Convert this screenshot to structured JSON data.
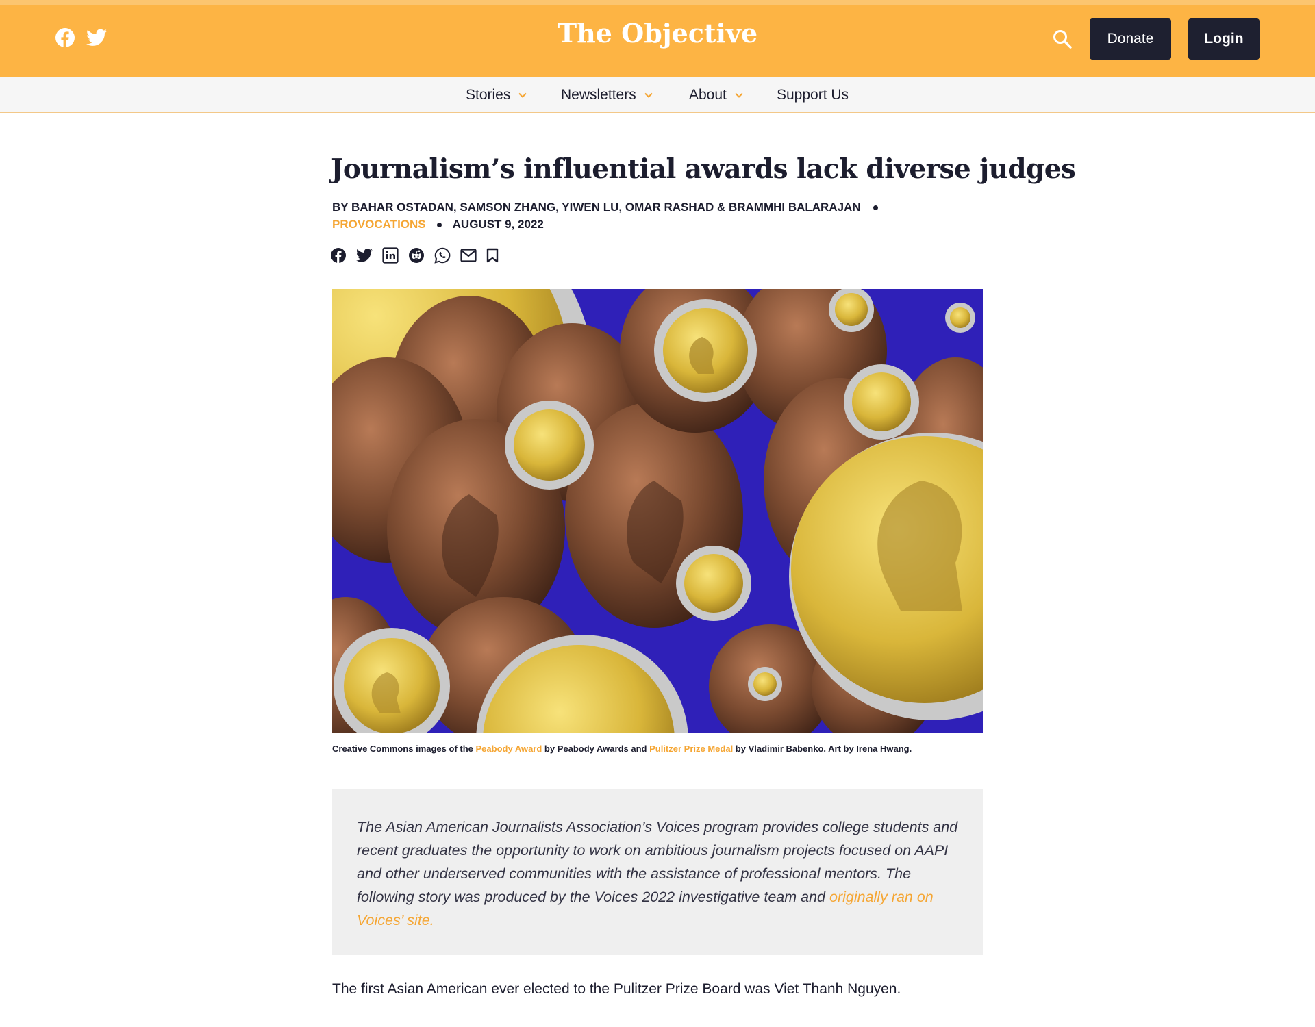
{
  "header": {
    "site_title": "The Objective",
    "donate_label": "Donate",
    "login_label": "Login",
    "social_icons": [
      "facebook-icon",
      "twitter-icon"
    ],
    "search_icon": "search-icon",
    "bg_color": "#fdb444",
    "button_color": "#1e2030"
  },
  "nav": {
    "items": [
      {
        "label": "Stories",
        "has_dropdown": true
      },
      {
        "label": "Newsletters",
        "has_dropdown": true
      },
      {
        "label": "About",
        "has_dropdown": true
      },
      {
        "label": "Support Us",
        "has_dropdown": false
      }
    ]
  },
  "article": {
    "title": "Journalism’s influential awards lack diverse judges",
    "byline": "BY BAHAR OSTADAN, SAMSON ZHANG, YIWEN LU, OMAR RASHAD & BRAMMHI BALARAJAN",
    "category": "PROVOCATIONS",
    "date": "AUGUST 9, 2022",
    "share_icons": [
      "facebook-icon",
      "twitter-icon",
      "linkedin-icon",
      "reddit-icon",
      "whatsapp-icon",
      "email-icon",
      "bookmark-icon"
    ],
    "caption": {
      "part1": "Creative Commons images of the ",
      "link1": "Peabody Award",
      "part2": " by Peabody Awards and ",
      "link2": "Pulitzer Prize Medal",
      "part3": " by Vladimir Babenko. Art by Irena Hwang."
    },
    "intro": {
      "text": "The Asian American Journalists Association’s Voices program provides college students and recent graduates the opportunity to work on ambitious journalism projects focused on AAPI and other underserved communities with the assistance of professional mentors. The following story was produced by the Voices 2022 investigative team and ",
      "link": "originally ran on Voices’ site."
    },
    "first_paragraph": "The first Asian American ever elected to the Pulitzer Prize Board was Viet Thanh Nguyen.",
    "accent_color": "#f5a634"
  }
}
